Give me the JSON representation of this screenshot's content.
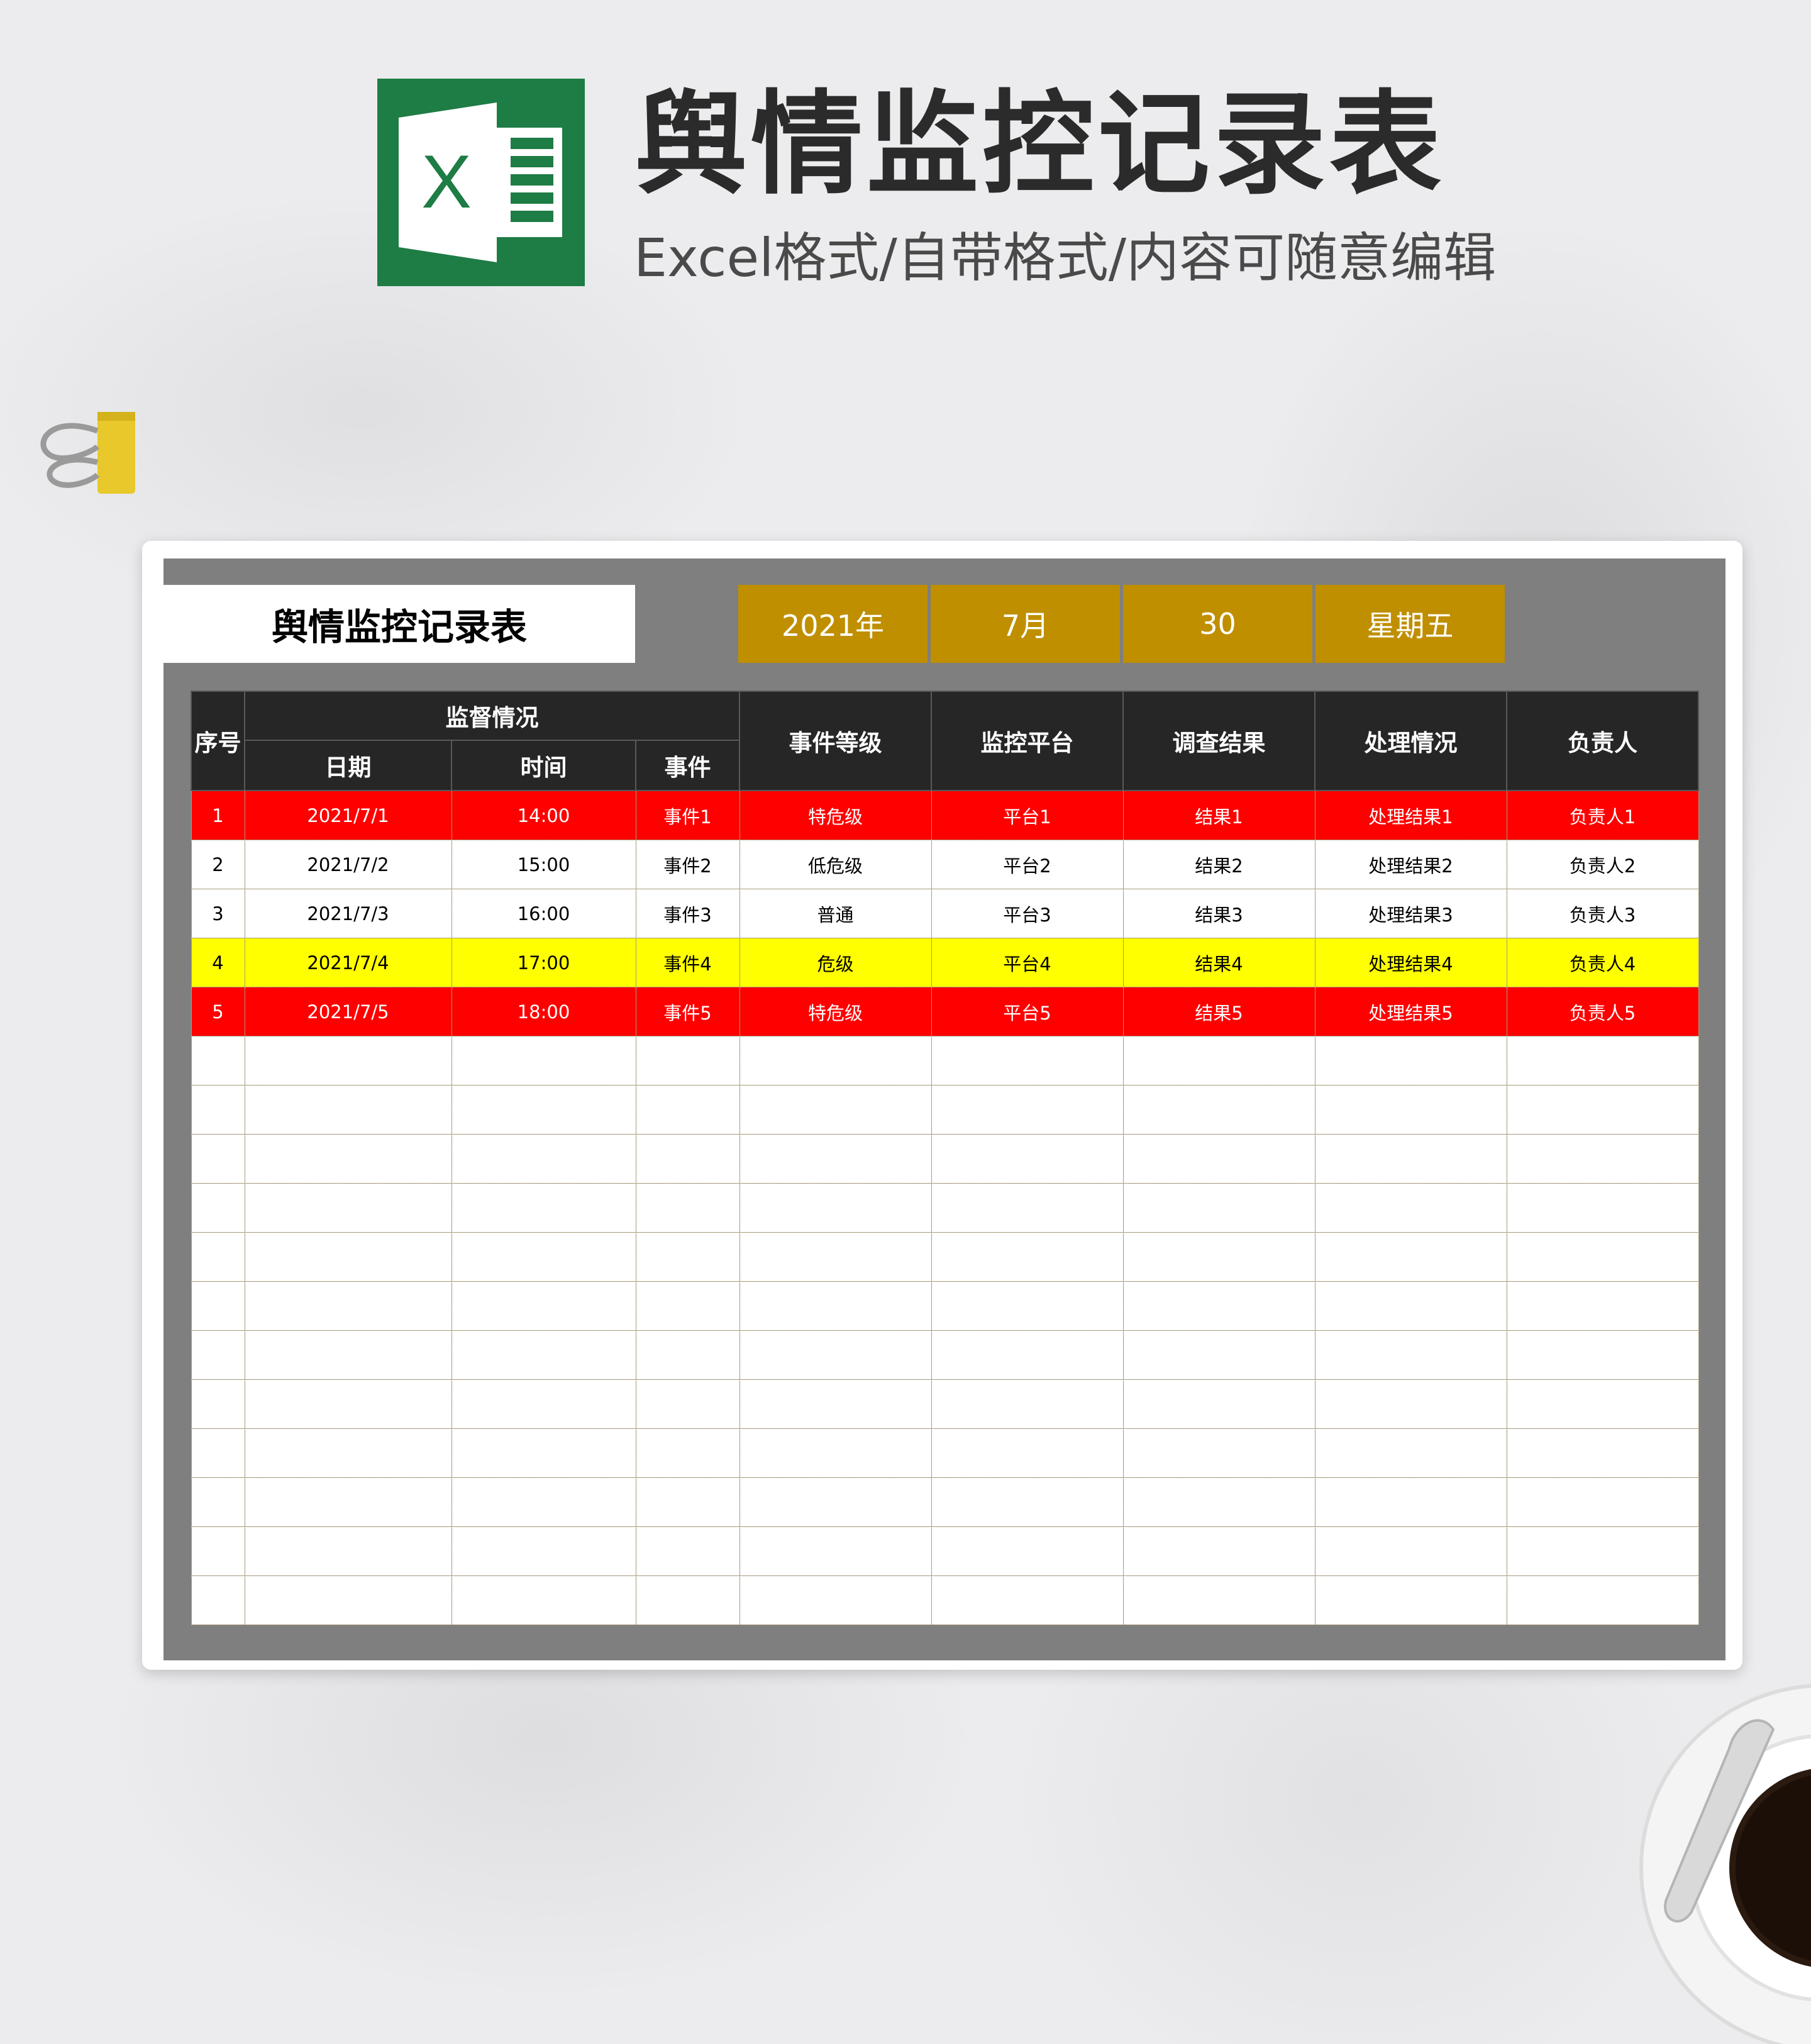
{
  "promo": {
    "heading": "舆情监控记录表",
    "subheading": "Excel格式/自带格式/内容可随意编辑",
    "logo_letter": "X",
    "logo_color": "#1e7c45"
  },
  "sheet": {
    "title": "舆情监控记录表",
    "date": {
      "year": "2021年",
      "month": "7月",
      "day": "30",
      "weekday": "星期五"
    },
    "header_group_label": "监督情况",
    "columns": {
      "index": "序号",
      "date": "日期",
      "time": "时间",
      "event": "事件",
      "level": "事件等级",
      "platform": "监控平台",
      "result": "调查结果",
      "handling": "处理情况",
      "owner": "负责人"
    },
    "rows": [
      {
        "index": "1",
        "date": "2021/7/1",
        "time": "14:00",
        "event": "事件1",
        "level": "特危级",
        "platform": "平台1",
        "result": "结果1",
        "handling": "处理结果1",
        "owner": "负责人1",
        "highlight": "red"
      },
      {
        "index": "2",
        "date": "2021/7/2",
        "time": "15:00",
        "event": "事件2",
        "level": "低危级",
        "platform": "平台2",
        "result": "结果2",
        "handling": "处理结果2",
        "owner": "负责人2",
        "highlight": "none"
      },
      {
        "index": "3",
        "date": "2021/7/3",
        "time": "16:00",
        "event": "事件3",
        "level": "普通",
        "platform": "平台3",
        "result": "结果3",
        "handling": "处理结果3",
        "owner": "负责人3",
        "highlight": "none"
      },
      {
        "index": "4",
        "date": "2021/7/4",
        "time": "17:00",
        "event": "事件4",
        "level": "危级",
        "platform": "平台4",
        "result": "结果4",
        "handling": "处理结果4",
        "owner": "负责人4",
        "highlight": "yellow"
      },
      {
        "index": "5",
        "date": "2021/7/5",
        "time": "18:00",
        "event": "事件5",
        "level": "特危级",
        "platform": "平台5",
        "result": "结果5",
        "handling": "处理结果5",
        "owner": "负责人5",
        "highlight": "red"
      }
    ],
    "empty_rows": 12,
    "colors": {
      "frame": "#7f7f7f",
      "header": "#262626",
      "date_box": "#bf8f00",
      "red_row": "#ff0000",
      "yellow_row": "#ffff00",
      "grid_line": "#c9b77a"
    }
  }
}
